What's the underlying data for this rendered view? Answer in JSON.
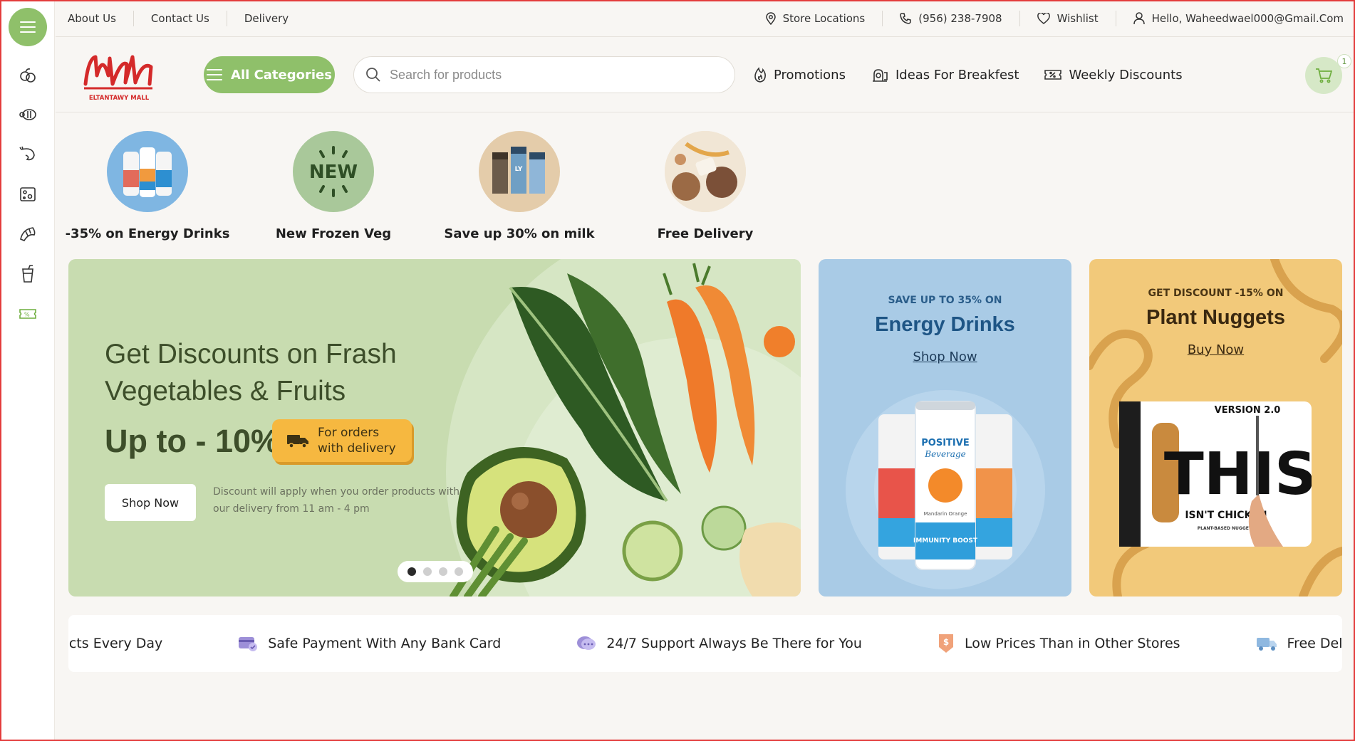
{
  "topbar": {
    "about": "About Us",
    "contact": "Contact Us",
    "delivery": "Delivery",
    "stores": "Store Locations",
    "phone": "(956) 238-7908",
    "wishlist": "Wishlist",
    "user": "Hello, Waheedwael000@Gmail.Com"
  },
  "header": {
    "logo_text": "ELTANTAWY MALL",
    "categories_label": "All Categories",
    "search_placeholder": "Search for products",
    "nav": [
      "Promotions",
      "Ideas For Breakfest",
      "Weekly Discounts"
    ],
    "cart_count": "1"
  },
  "sidebar": {
    "icons": [
      "fruit-icon",
      "sausage-icon",
      "shrimp-icon",
      "cheese-icon",
      "croissant-icon",
      "drink-icon",
      "discount-icon"
    ]
  },
  "promo_circles": [
    {
      "label": "-35% on Energy Drinks"
    },
    {
      "label": "New Frozen Veg",
      "badge": "NEW"
    },
    {
      "label": "Save up 30% on milk"
    },
    {
      "label": "Free Delivery"
    }
  ],
  "hero": {
    "title": "Get Discounts on Frash Vegetables & Fruits",
    "discount": "Up to - 10%",
    "delivery_tag": "For orders with delivery",
    "shop_label": "Shop Now",
    "note": "Discount will apply when you order products with our delivery from 11 am - 4 pm",
    "slide_active": 1,
    "slide_count": 4
  },
  "promo_energy": {
    "eyebrow": "SAVE UP TO 35% ON",
    "title": "Energy Drinks",
    "link": "Shop Now",
    "can_brand": "POSITIVE",
    "can_sub": "Beverage",
    "can_flavor": "Mandarin Orange",
    "can_tag": "IMMUNITY BOOST"
  },
  "promo_nuggets": {
    "eyebrow": "GET DISCOUNT -15% ON",
    "title": "Plant Nuggets",
    "link": "Buy Now",
    "pack_version": "VERSION 2.0",
    "pack_brand": "THIS",
    "pack_tagline": "ISN'T CHICKEN",
    "pack_sub": "PLANT-BASED NUGGETS"
  },
  "features": [
    "Fresh Products Every Day",
    "Safe Payment With Any Bank Card",
    "24/7 Support Always Be There for You",
    "Low Prices Than in Other Stores",
    "Free Delivery From"
  ],
  "colors": {
    "brand_green": "#8fc06a",
    "hero_bg": "#c8dcb0",
    "energy_bg": "#a9cbe6",
    "nuggets_bg": "#f2c97a",
    "logo_red": "#d42a2a"
  }
}
